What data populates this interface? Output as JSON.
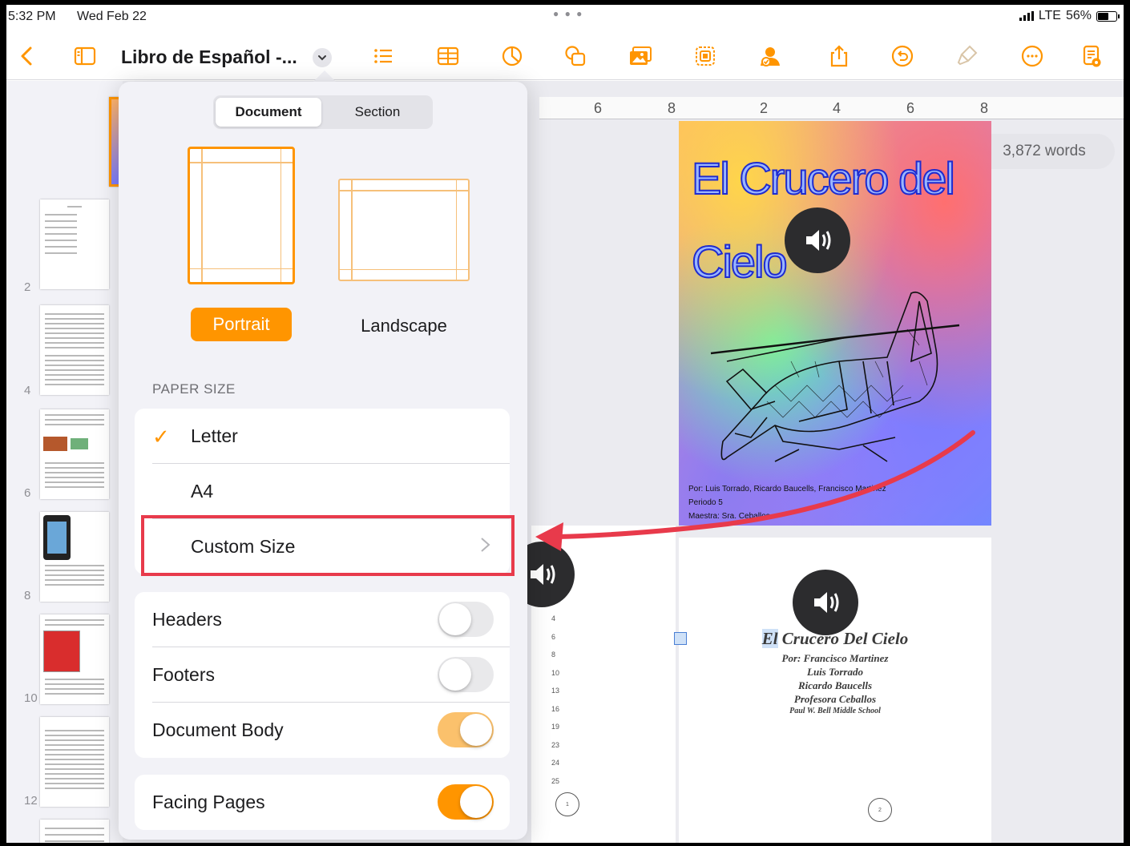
{
  "status_bar": {
    "time": "5:32 PM",
    "date": "Wed Feb 22",
    "network": "LTE",
    "battery": "56%"
  },
  "toolbar": {
    "doc_title": "Libro de Español -...",
    "icons": [
      "back-chevron-icon",
      "sidebar-icon",
      "title-menu-chevron-icon",
      "list-icon",
      "table-icon",
      "chart-icon",
      "shapes-icon",
      "media-icon",
      "copy-icon",
      "collaborate-icon",
      "share-icon",
      "undo-icon",
      "format-brush-icon",
      "more-icon",
      "document-setup-icon"
    ]
  },
  "sidebar": {
    "page_numbers": [
      "2",
      "4",
      "6",
      "8",
      "10",
      "12"
    ]
  },
  "ruler": {
    "labels": [
      "6",
      "8",
      "2",
      "4",
      "6",
      "8"
    ]
  },
  "word_count": "3,872 words",
  "cover": {
    "title_line1": "El Crucero del",
    "title_line2": "Cielo",
    "credits": [
      "Por: Luis Torrado, Ricardo Baucells, Francisco Martinez",
      "Periodo 5",
      "Maestra: Sra. Ceballos"
    ]
  },
  "title_page": {
    "title_word1": "El",
    "title_rest": " Crucero Del Cielo",
    "lines": [
      "Por: Francisco Martinez",
      "Luis Torrado",
      "Ricardo Baucells",
      "Profesora Ceballos"
    ],
    "school": "Paul W. Bell Middle School",
    "page_left_number": "1",
    "page_right_number": "2"
  },
  "line_numbers": [
    "4",
    "6",
    "8",
    "10",
    "13",
    "16",
    "19",
    "23",
    "24",
    "25"
  ],
  "popover": {
    "segments": {
      "document": "Document",
      "section": "Section",
      "selected": "Document"
    },
    "orientation": {
      "portrait": "Portrait",
      "landscape": "Landscape",
      "selected": "Portrait"
    },
    "paper_size_header": "PAPER SIZE",
    "paper_sizes": [
      {
        "label": "Letter",
        "checked": true
      },
      {
        "label": "A4",
        "checked": false
      },
      {
        "label": "Custom Size",
        "checked": false
      }
    ],
    "toggles": [
      {
        "label": "Headers",
        "on": false
      },
      {
        "label": "Footers",
        "on": false
      },
      {
        "label": "Document Body",
        "on": true
      }
    ],
    "facing_pages": {
      "label": "Facing Pages",
      "on": true
    }
  },
  "colors": {
    "accent": "#ff9500",
    "annotation_red": "#e83a4b"
  }
}
